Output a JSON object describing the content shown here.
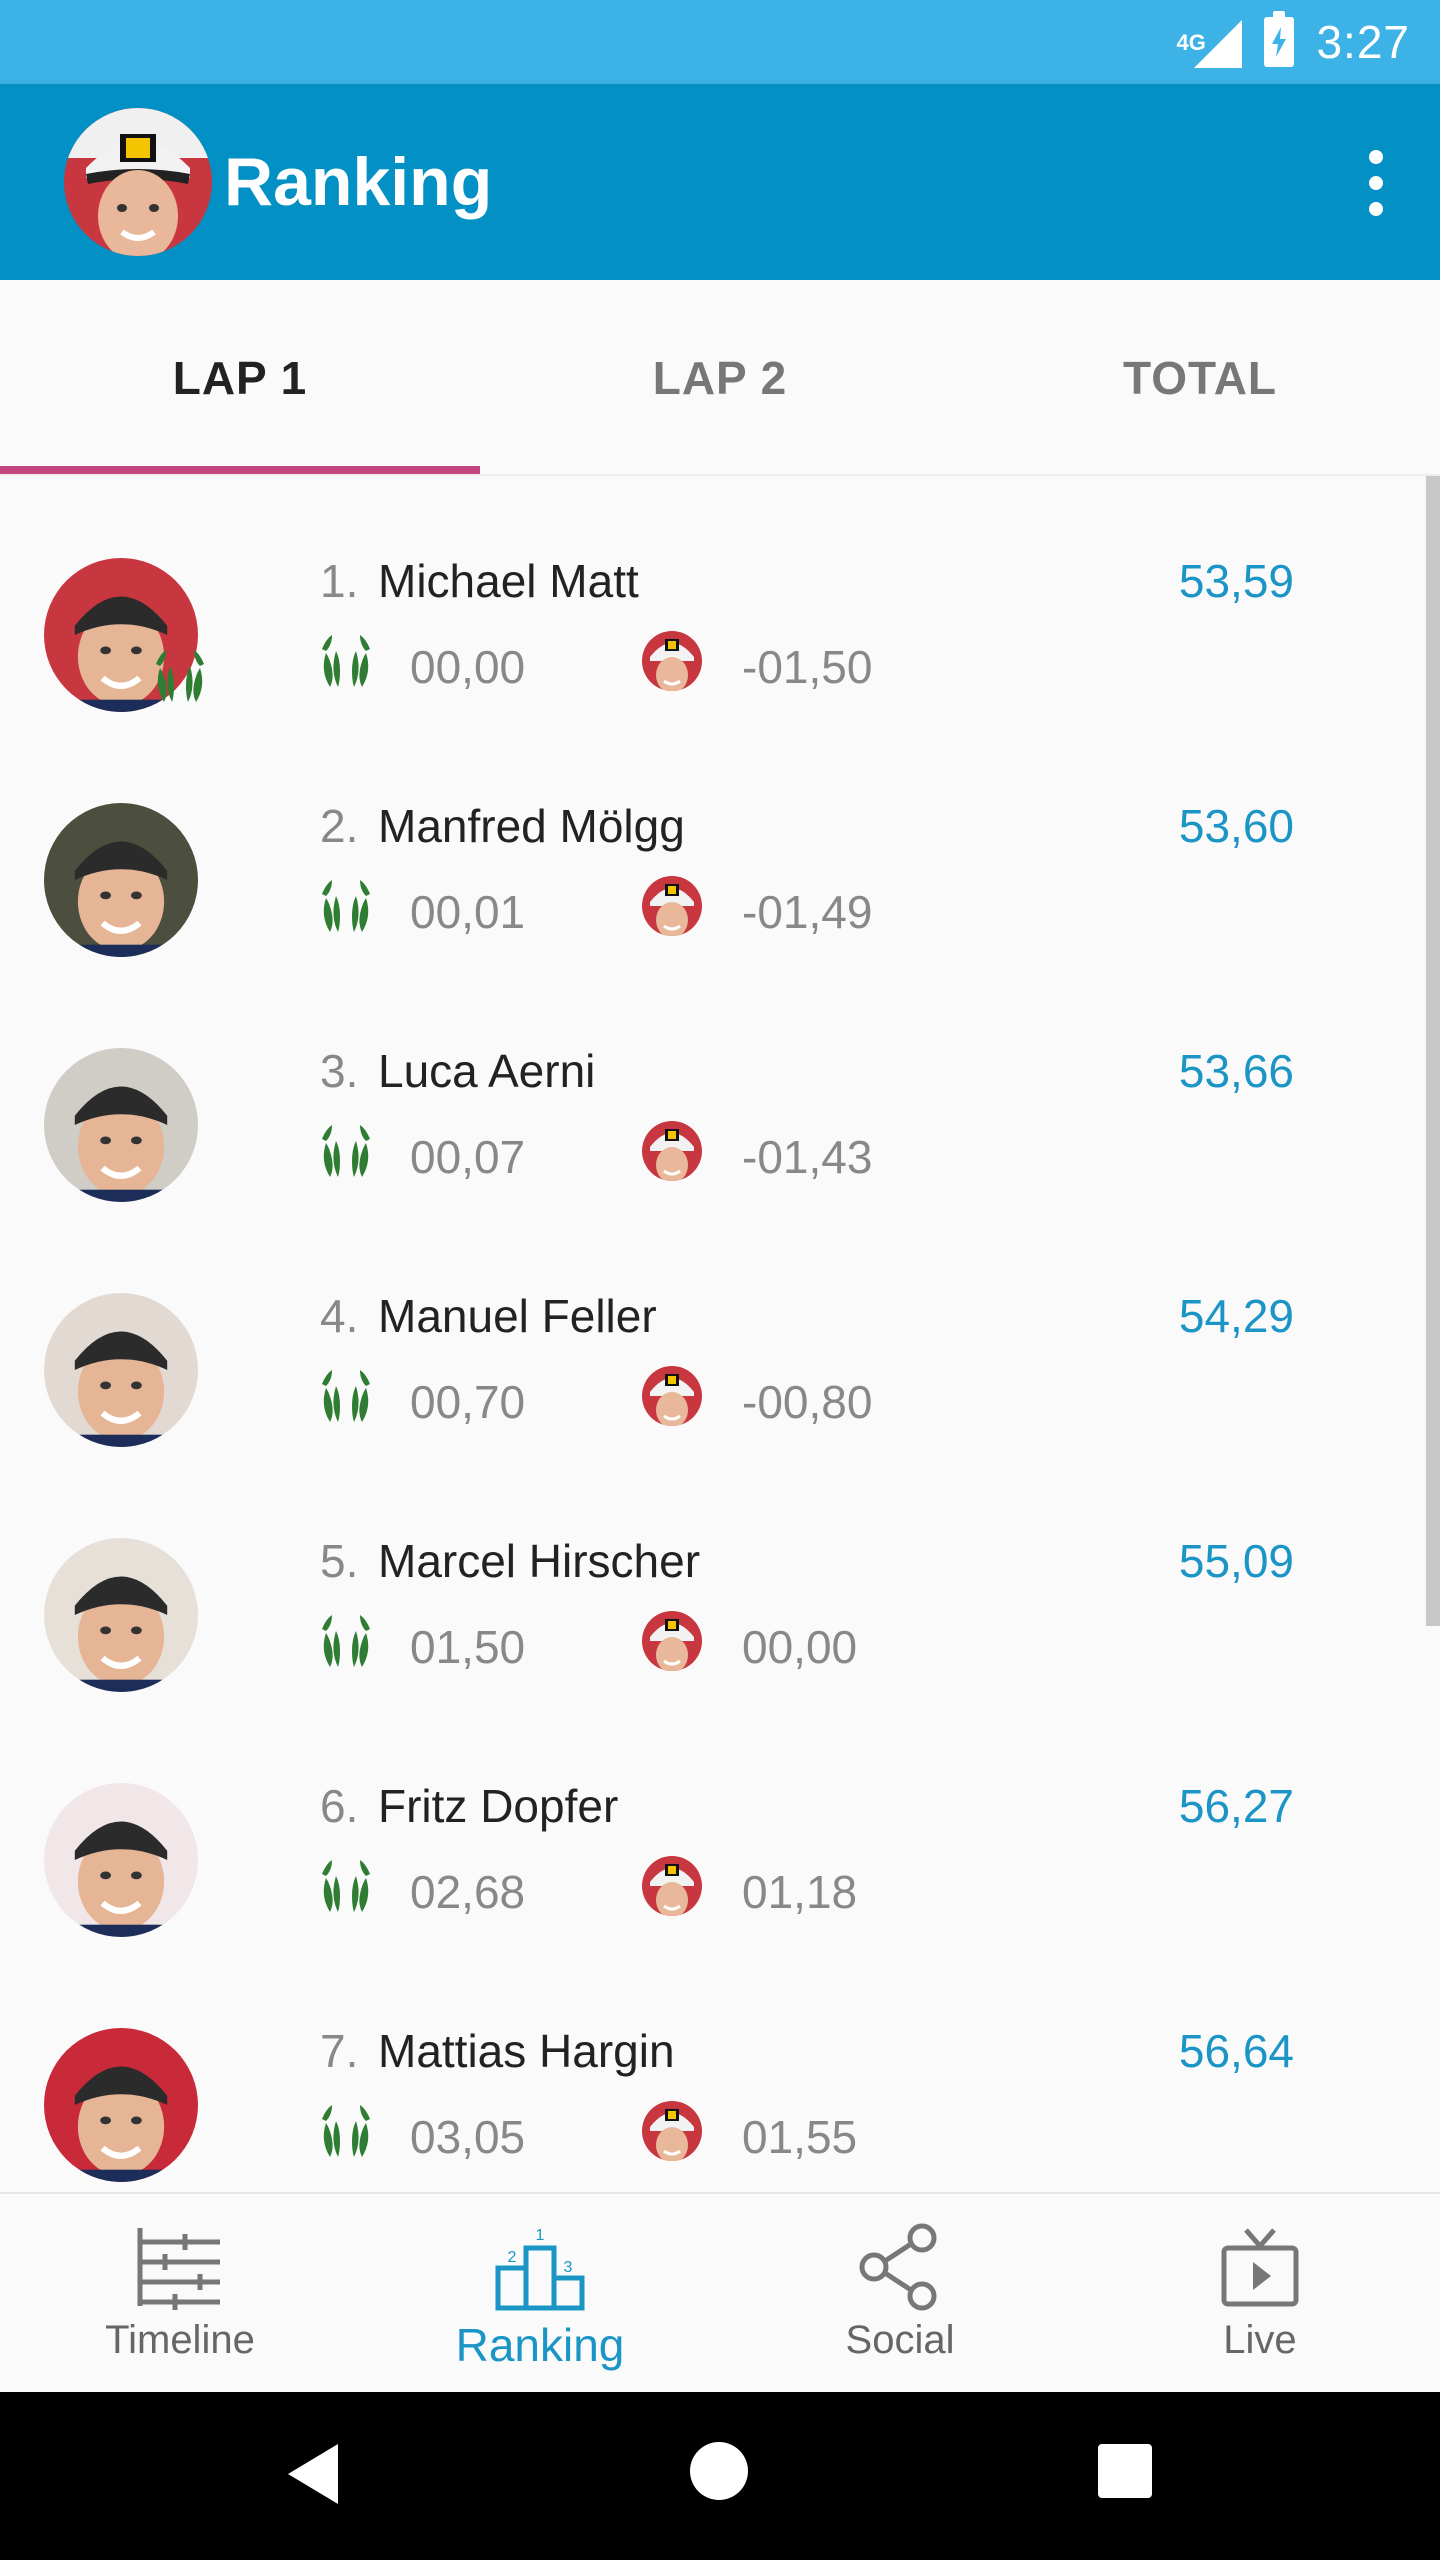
{
  "status_bar": {
    "network": "4G",
    "time": "3:27"
  },
  "app_bar": {
    "title": "Ranking",
    "avatar_icon": "profile-avatar-icon",
    "menu_icon": "more-vert-icon"
  },
  "tabs": [
    {
      "label": "LAP 1",
      "active": true
    },
    {
      "label": "LAP 2",
      "active": false
    },
    {
      "label": "TOTAL",
      "active": false
    }
  ],
  "ranking": [
    {
      "rank": "1.",
      "name": "Michael Matt",
      "time": "53,59",
      "diff_leader": "00,00",
      "diff_favorite": "-01,50",
      "avatar_color": "#c8373f",
      "has_badge": true
    },
    {
      "rank": "2.",
      "name": "Manfred Mölgg",
      "time": "53,60",
      "diff_leader": "00,01",
      "diff_favorite": "-01,49",
      "avatar_color": "#4c4f3e",
      "has_badge": false
    },
    {
      "rank": "3.",
      "name": "Luca Aerni",
      "time": "53,66",
      "diff_leader": "00,07",
      "diff_favorite": "-01,43",
      "avatar_color": "#d0ccc6",
      "has_badge": false
    },
    {
      "rank": "4.",
      "name": "Manuel Feller",
      "time": "54,29",
      "diff_leader": "00,70",
      "diff_favorite": "-00,80",
      "avatar_color": "#e3d9d3",
      "has_badge": false
    },
    {
      "rank": "5.",
      "name": "Marcel Hirscher",
      "time": "55,09",
      "diff_leader": "01,50",
      "diff_favorite": "00,00",
      "avatar_color": "#e7e0d8",
      "has_badge": false
    },
    {
      "rank": "6.",
      "name": "Fritz Dopfer",
      "time": "56,27",
      "diff_leader": "02,68",
      "diff_favorite": "01,18",
      "avatar_color": "#f1e6e8",
      "has_badge": false
    },
    {
      "rank": "7.",
      "name": "Mattias Hargin",
      "time": "56,64",
      "diff_leader": "03,05",
      "diff_favorite": "01,55",
      "avatar_color": "#c82a3a",
      "has_badge": false
    }
  ],
  "bottom_nav": [
    {
      "label": "Timeline",
      "icon": "timeline-icon",
      "active": false
    },
    {
      "label": "Ranking",
      "icon": "podium-icon",
      "active": true
    },
    {
      "label": "Social",
      "icon": "share-icon",
      "active": false
    },
    {
      "label": "Live",
      "icon": "tv-icon",
      "active": false
    }
  ],
  "colors": {
    "primary": "#0290c5",
    "status": "#3db2e6",
    "accent": "#c2457f",
    "time": "#1a95c6",
    "laurel": "#2e7d32"
  }
}
